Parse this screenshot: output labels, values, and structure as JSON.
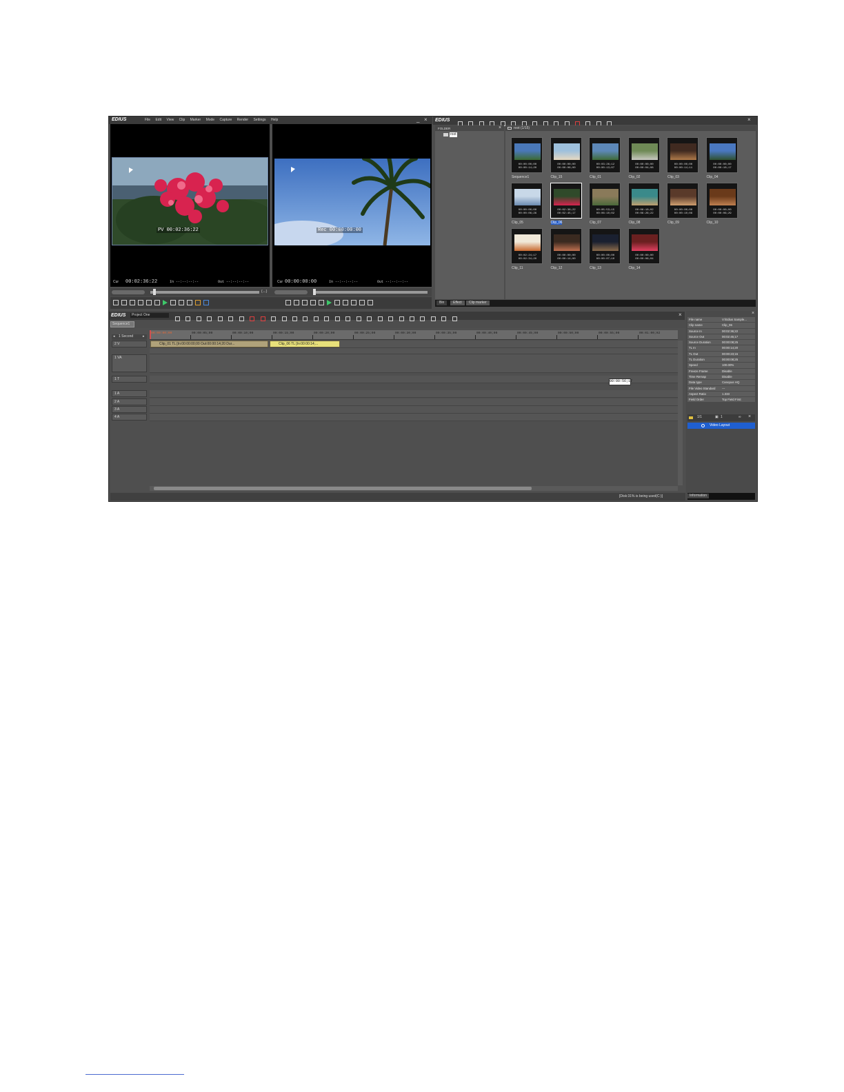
{
  "player": {
    "app_name": "EDIUS",
    "menu": [
      "File",
      "Edit",
      "View",
      "Clip",
      "Marker",
      "Mode",
      "Capture",
      "Render",
      "Settings",
      "Help"
    ],
    "player_overlay_tc": "PV 00:02:36:22",
    "recorder_overlay_tc": "Rec 00:00:00:00",
    "player_cur_label": "Cur",
    "player_cur": "00:02:36:22",
    "player_in": "In --:--:--:--",
    "player_out": "Out --:--:--:--",
    "recorder_cur_label": "Cur",
    "recorder_cur": "00:00:00:00",
    "recorder_in": "In --:--:--:--",
    "recorder_out": "Out --:--:--:--"
  },
  "bin": {
    "app_name": "EDIUS",
    "folder_header": "FOLDER",
    "root_label": "root",
    "path_label": "root (1/15)",
    "tabs": [
      "Bin",
      "Effect",
      "Clip marker"
    ],
    "clips": [
      {
        "name": "Sequence1",
        "tc1": "00:00:00;00",
        "tc2": "00:00:14;20"
      },
      {
        "name": "Clip_15",
        "tc1": "00:00:00;00",
        "tc2": "00:00:06;00"
      },
      {
        "name": "Clip_01",
        "tc1": "00:03:26;12",
        "tc2": "00:00:13;07"
      },
      {
        "name": "Clip_02",
        "tc1": "00:00:00;00",
        "tc2": "00:00:04;08"
      },
      {
        "name": "Clip_03",
        "tc1": "00:00:00;00",
        "tc2": "00:00:14;11"
      },
      {
        "name": "Clip_04",
        "tc1": "00:00:00;00",
        "tc2": "00:00:10;17"
      },
      {
        "name": "Clip_05",
        "tc1": "00:00:00;00",
        "tc2": "00:00:06;26"
      },
      {
        "name": "Clip_06",
        "tc1": "00:02:36;22",
        "tc2": "00:02:45;17"
      },
      {
        "name": "Clip_07",
        "tc1": "00:05:53;15",
        "tc2": "00:06:10;02"
      },
      {
        "name": "Clip_08",
        "tc1": "00:06:10;02",
        "tc2": "00:06:26;22"
      },
      {
        "name": "Clip_09",
        "tc1": "00:00:00;00",
        "tc2": "00:00:10;06"
      },
      {
        "name": "Clip_10",
        "tc1": "00:00:00;00",
        "tc2": "00:00:06;29"
      },
      {
        "name": "Clip_11",
        "tc1": "00:02:24;17",
        "tc2": "00:02:34;20"
      },
      {
        "name": "Clip_12",
        "tc1": "00:00:00;00",
        "tc2": "00:00:14;00"
      },
      {
        "name": "Clip_13",
        "tc1": "00:00:00;00",
        "tc2": "00:00:07;10"
      },
      {
        "name": "Clip_14",
        "tc1": "00:00:00;00",
        "tc2": "00:00:06;04"
      }
    ]
  },
  "timeline": {
    "app_name": "EDIUS",
    "project_name": "Project One",
    "sequence_tab": "Sequence1",
    "scale_label": "1 Second",
    "ruler": [
      "00:00:00;00",
      "00:00:05;00",
      "00:00:10;00",
      "00:00:15;00",
      "00:00:20;00",
      "00:00:25;00",
      "00:00:30;00",
      "00:00:35;00",
      "00:00:40;00",
      "00:00:45;00",
      "00:00:50;00",
      "00:00:55;00",
      "00:01:00;02"
    ],
    "tracks": [
      "2 V",
      "1 VA",
      "1 T",
      "1 A",
      "2 A",
      "3 A",
      "4 A"
    ],
    "clip1_label": "Clip_01  TL [In:00:00:00;00 Out:00:00:14;20 Dur...",
    "clip2_label": "Clip_06  TL [In:00:00:14;...",
    "tc_box": "00:00:56;17",
    "status": "[Disk:31% is being used(C:)]"
  },
  "info": {
    "rows": [
      {
        "k": "File name",
        "v": "V:\\Edius Sample..."
      },
      {
        "k": "Clip name",
        "v": "Clip_06"
      },
      {
        "k": "Source In",
        "v": "00:02:36;22"
      },
      {
        "k": "Source Out",
        "v": "00:02:45;17"
      },
      {
        "k": "Source Duration",
        "v": "00:00:08;25"
      },
      {
        "k": "TL In",
        "v": "00:00:14;20"
      },
      {
        "k": "TL Out",
        "v": "00:00:23;15"
      },
      {
        "k": "TL Duration",
        "v": "00:00:08;25"
      },
      {
        "k": "Speed",
        "v": "100.00%"
      },
      {
        "k": "Freeze Frame",
        "v": "Disable"
      },
      {
        "k": "Time Remap",
        "v": "Disable"
      },
      {
        "k": "Data type",
        "v": "Canopus HQ"
      },
      {
        "k": "File Video Standard",
        "v": "---"
      },
      {
        "k": "Aspect Ratio",
        "v": "1.333"
      },
      {
        "k": "Field Order",
        "v": "Top Field First"
      }
    ],
    "count": "1/1",
    "count2": "1",
    "layout_item": "Video Layout",
    "tab": "Information"
  }
}
